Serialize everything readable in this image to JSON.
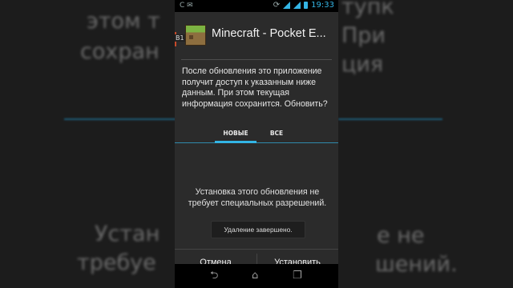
{
  "status_bar": {
    "time": "19:33",
    "left_icons": "C  ✉"
  },
  "dialog": {
    "side_tag": "B1",
    "title": "Minecraft - Pocket E...",
    "message": "После обновления это приложение получит доступ к указанным ниже данным. При этом текущая информация сохранится. Обновить?",
    "tabs": [
      "НОВЫЕ",
      "ВСЕ"
    ],
    "active_tab": "НОВЫЕ",
    "no_permissions": "Установка этого обновления не требует специальных разрешений.",
    "toast": "Удаление завершено.",
    "buttons": {
      "cancel": "Отмена",
      "install": "Установить"
    }
  },
  "background_text": {
    "left_top": [
      "этом т",
      "сохран"
    ],
    "left_bottom": [
      "Устан",
      "требуе"
    ],
    "right_top": [
      "тупк",
      "При",
      "ция"
    ],
    "right_bottom": [
      "е не",
      "шений."
    ]
  },
  "nav_icons": [
    "back-icon",
    "home-icon",
    "recent-apps-icon"
  ],
  "colors": {
    "accent": "#33b5e5",
    "dialog_bg": "#2b2b2b"
  }
}
